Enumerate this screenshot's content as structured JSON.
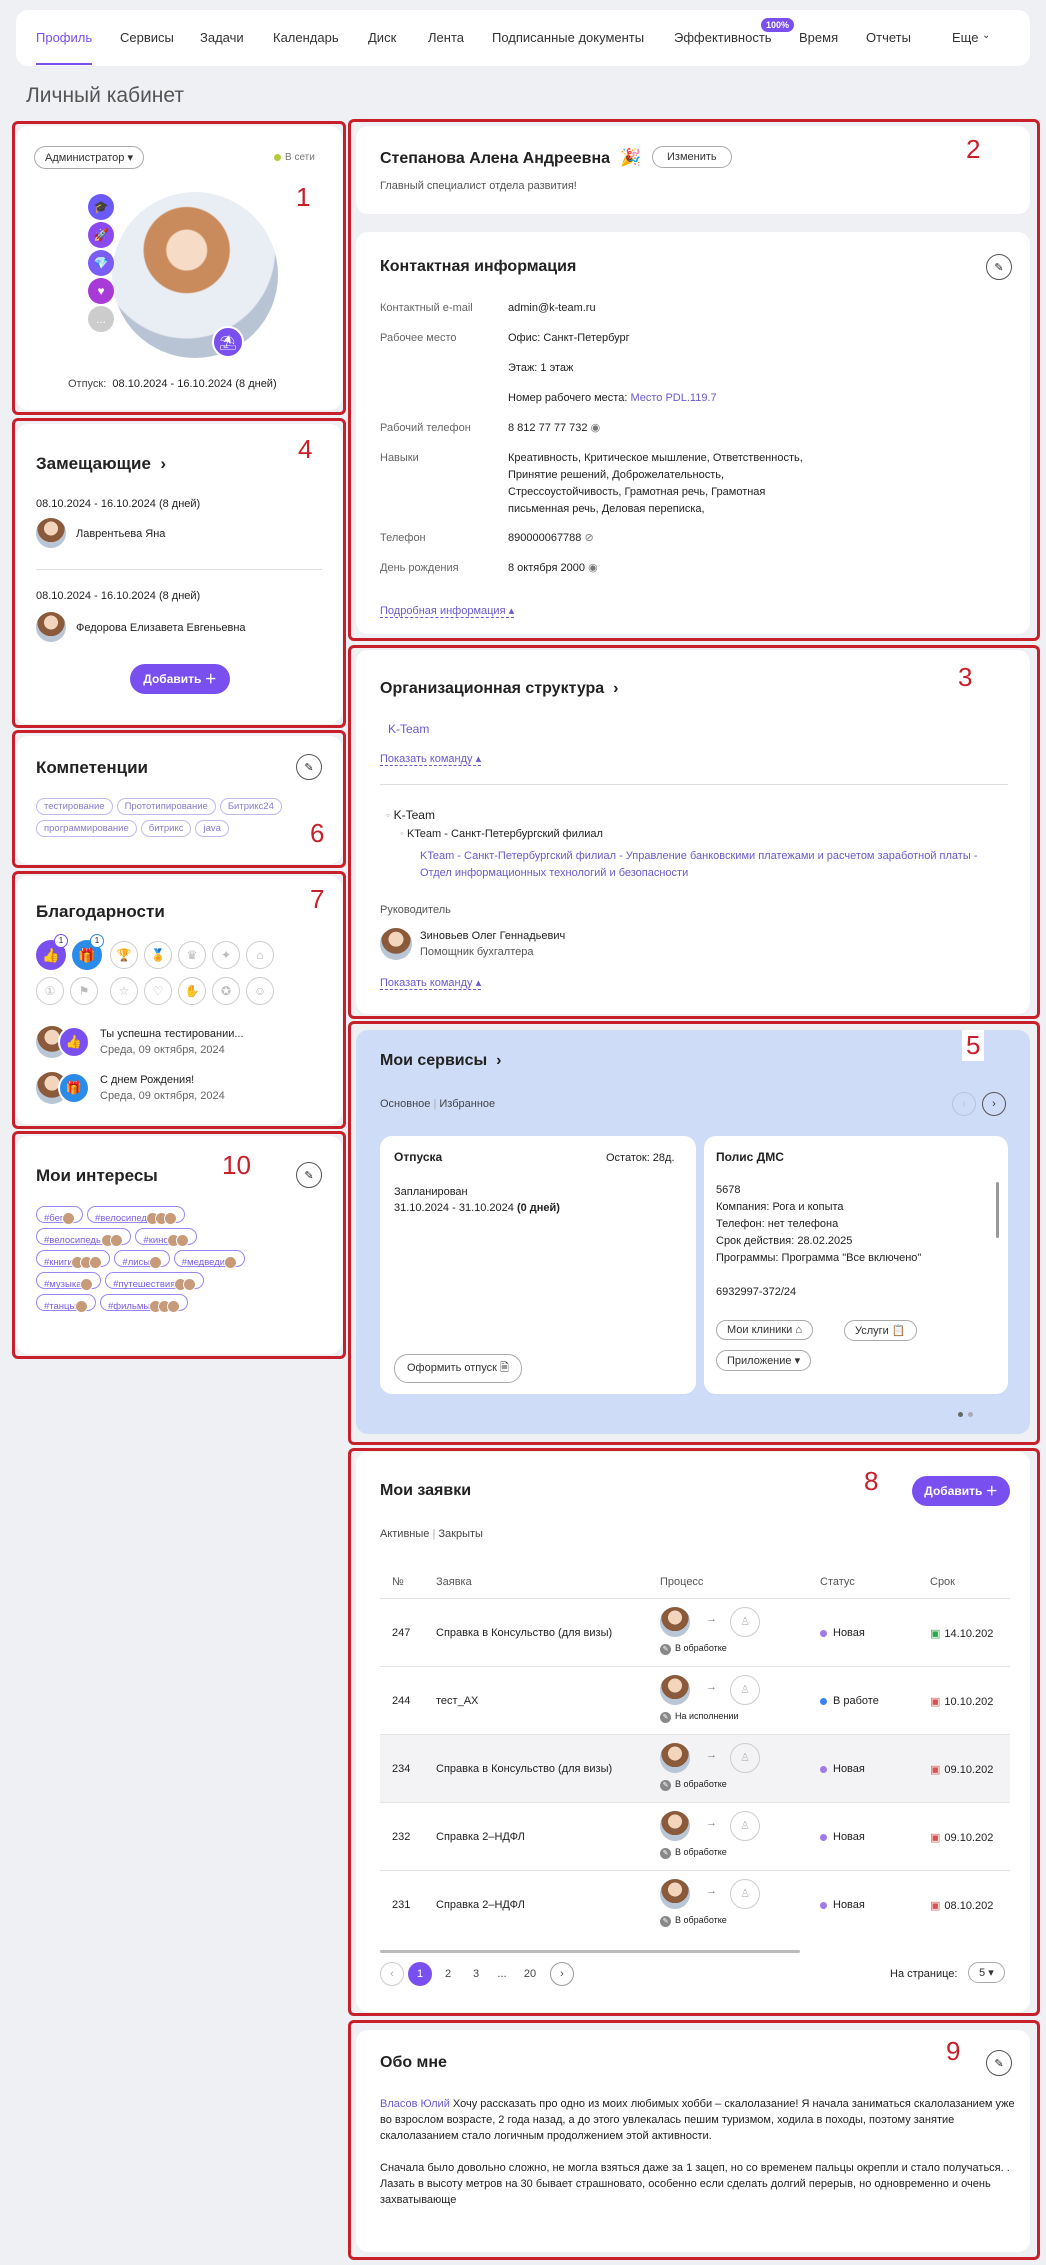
{
  "nav": {
    "items": [
      "Профиль",
      "Сервисы",
      "Задачи",
      "Календарь",
      "Диск",
      "Лента",
      "Подписанные документы",
      "Эффективность",
      "Время",
      "Отчеты",
      "Еще"
    ],
    "badge": "100%"
  },
  "page_title": "Личный кабинет",
  "annotations": [
    "1",
    "2",
    "3",
    "4",
    "5",
    "6",
    "7",
    "8",
    "9",
    "10"
  ],
  "profile": {
    "role": "Администратор",
    "status": "В сети",
    "vacation_label": "Отпуск:",
    "vacation": "08.10.2024 - 16.10.2024 (8 дней)",
    "more": "..."
  },
  "header": {
    "name": "Степанова Алена Андреевна",
    "edit": "Изменить",
    "position": "Главный специалист отдела развития!"
  },
  "contacts": {
    "title": "Контактная информация",
    "email_label": "Контактный e-mail",
    "email": "admin@k-team.ru",
    "workplace_label": "Рабочее место",
    "office": "Офис: Санкт-Петербург",
    "floor": "Этаж: 1 этаж",
    "place_label": "Номер рабочего места:",
    "place": "Место PDL.119.7",
    "work_phone_label": "Рабочий телефон",
    "work_phone": "8 812 77 77 732",
    "skills_label": "Навыки",
    "skills": [
      "Креативность, Критическое мышление, Ответственность,",
      "Принятие решений, Доброжелательность,",
      "Стрессоустойчивость, Грамотная речь, Грамотная",
      "письменная речь, Деловая переписка,"
    ],
    "phone_label": "Телефон",
    "phone": "890000067788",
    "birthday_label": "День рождения",
    "birthday": "8 октября 2000",
    "more": "Подробная информация"
  },
  "org": {
    "title": "Организационная структура",
    "team": "K-Team",
    "show_team": "Показать команду",
    "tree": [
      "K-Team",
      "KTeam - Санкт-Петербургский филиал",
      "KTeam - Санкт-Петербургский филиал - Управление банковскими платежами и расчетом заработной платы -",
      "Отдел информационных технологий и безопасности"
    ],
    "head_label": "Руководитель",
    "head_name": "Зиновьев Олег Геннадьевич",
    "head_position": "Помощник бухгалтера",
    "show_team2": "Показать команду"
  },
  "deputies": {
    "title": "Замещающие",
    "items": [
      {
        "dates": "08.10.2024 - 16.10.2024 (8 дней)",
        "name": "Лаврентьева Яна"
      },
      {
        "dates": "08.10.2024 - 16.10.2024 (8 дней)",
        "name": "Федорова Елизавета Евгеньевна"
      }
    ],
    "add": "Добавить"
  },
  "competencies": {
    "title": "Компетенции",
    "tags": [
      "тестирование",
      "Прототипирование",
      "Битрикс24",
      "программирование",
      "битрикс",
      "java"
    ]
  },
  "thanks": {
    "title": "Благодарности",
    "counts": [
      "1",
      "1"
    ],
    "items": [
      {
        "text": "Ты успешна тестировании...",
        "date": "Среда, 09 октября, 2024"
      },
      {
        "text": "С днем Рождения!",
        "date": "Среда, 09 октября, 2024"
      }
    ]
  },
  "interests": {
    "title": "Мои интересы",
    "tags": [
      "#бег",
      "#велосипед",
      "#велосипеды",
      "#кино",
      "#книги",
      "#лисы",
      "#медведи",
      "#музыка",
      "#путешествия",
      "#танцы",
      "#фильмы"
    ]
  },
  "services": {
    "title": "Мои сервисы",
    "tabs": [
      "Основное",
      "Избранное"
    ],
    "vacation": {
      "title": "Отпуска",
      "balance": "Остаток: 28д.",
      "status": "Запланирован",
      "dates": "31.10.2024 - 31.10.2024",
      "days": "(0 дней)",
      "action": "Оформить отпуск"
    },
    "dms": {
      "title": "Полис ДМС",
      "lines": [
        "5678",
        "Компания: Рога и копыта",
        "Телефон: нет телефона",
        "Срок действия: 28.02.2025",
        "Программы: Программа \"Все включено\"",
        "",
        "6932997-372/24"
      ],
      "clinics": "Мои клиники",
      "services": "Услуги",
      "app": "Приложение"
    }
  },
  "requests": {
    "title": "Мои заявки",
    "add": "Добавить",
    "tabs": [
      "Активные",
      "Закрыты"
    ],
    "columns": [
      "№",
      "Заявка",
      "Процесс",
      "Статус",
      "Срок"
    ],
    "rows": [
      {
        "id": "247",
        "name": "Справка в Консульство (для визы)",
        "process": "В обработке",
        "status": "Новая",
        "date": "14.10.202",
        "color": "#a07ae8"
      },
      {
        "id": "244",
        "name": "тест_АХ",
        "process": "На исполнении",
        "status": "В работе",
        "date": "10.10.202",
        "color": "#3b82f6"
      },
      {
        "id": "234",
        "name": "Справка в Консульство (для визы)",
        "process": "В обработке",
        "status": "Новая",
        "date": "09.10.202",
        "color": "#a07ae8"
      },
      {
        "id": "232",
        "name": "Справка 2–НДФЛ",
        "process": "В обработке",
        "status": "Новая",
        "date": "09.10.202",
        "color": "#a07ae8"
      },
      {
        "id": "231",
        "name": "Справка 2–НДФЛ",
        "process": "В обработке",
        "status": "Новая",
        "date": "08.10.202",
        "color": "#a07ae8"
      }
    ],
    "pages": [
      "1",
      "2",
      "3",
      "...",
      "20"
    ],
    "per_page_label": "На странице:",
    "per_page": "5"
  },
  "about": {
    "title": "Обо мне",
    "author": "Власов Юлий",
    "p1": " Хочу рассказать про одно из моих любимых хобби – скалолазание! Я начала заниматься скалолазанием уже во взрослом возрасте, 2 года назад, а до этого увлекалась пешим туризмом, ходила в походы, поэтому занятие скалолазанием стало логичным продолжением этой активности.",
    "p2": "Сначала было довольно сложно, не могла взяться даже за 1 зацеп, но со временем пальцы окрепли и стало получаться. .",
    "p3": "Лазать в высоту метров на 30 бывает страшновато, особенно если сделать долгий перерыв, но одновременно и очень захватывающе"
  }
}
